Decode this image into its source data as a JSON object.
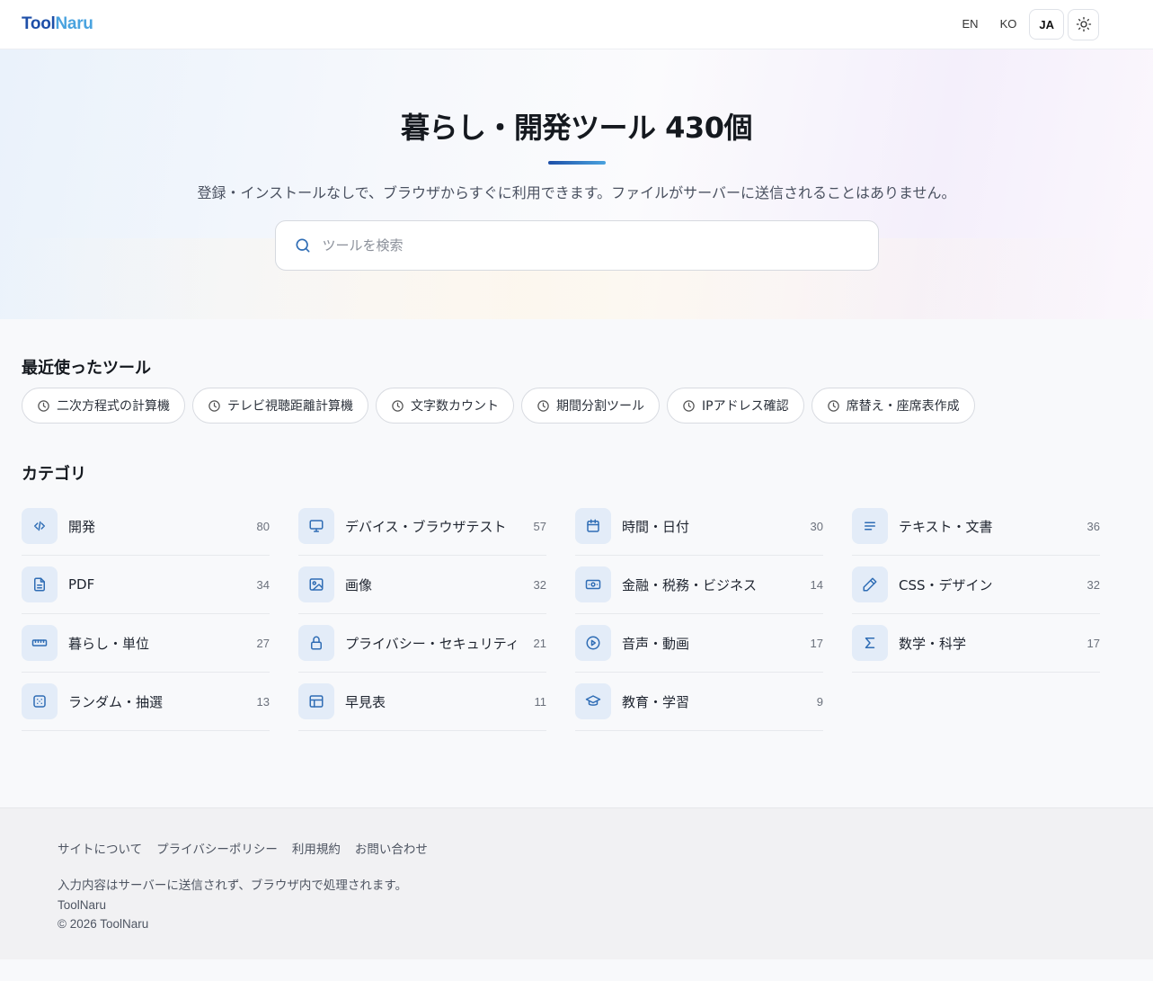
{
  "header": {
    "logo_part1": "Tool",
    "logo_part2": "Naru",
    "languages": [
      "EN",
      "KO",
      "JA"
    ],
    "active_language": "JA"
  },
  "hero": {
    "title": "暮らし・開発ツール 430個",
    "subtitle": "登録・インストールなしで、ブラウザからすぐに利用できます。ファイルがサーバーに送信されることはありません。",
    "search_placeholder": "ツールを検索"
  },
  "recent": {
    "title": "最近使ったツール",
    "items": [
      "二次方程式の計算機",
      "テレビ視聴距離計算機",
      "文字数カウント",
      "期間分割ツール",
      "IPアドレス確認",
      "席替え・座席表作成"
    ]
  },
  "categories": {
    "title": "カテゴリ",
    "items": [
      {
        "name": "開発",
        "count": "80",
        "icon": "code-icon"
      },
      {
        "name": "デバイス・ブラウザテスト",
        "count": "57",
        "icon": "monitor-icon"
      },
      {
        "name": "時間・日付",
        "count": "30",
        "icon": "calendar-icon"
      },
      {
        "name": "テキスト・文書",
        "count": "36",
        "icon": "text-lines-icon"
      },
      {
        "name": "PDF",
        "count": "34",
        "icon": "file-icon"
      },
      {
        "name": "画像",
        "count": "32",
        "icon": "image-icon"
      },
      {
        "name": "金融・税務・ビジネス",
        "count": "14",
        "icon": "banknote-icon"
      },
      {
        "name": "CSS・デザイン",
        "count": "32",
        "icon": "pencil-icon"
      },
      {
        "name": "暮らし・単位",
        "count": "27",
        "icon": "ruler-icon"
      },
      {
        "name": "プライバシー・セキュリティ",
        "count": "21",
        "icon": "lock-icon"
      },
      {
        "name": "音声・動画",
        "count": "17",
        "icon": "play-icon"
      },
      {
        "name": "数学・科学",
        "count": "17",
        "icon": "sigma-icon"
      },
      {
        "name": "ランダム・抽選",
        "count": "13",
        "icon": "dice-icon"
      },
      {
        "name": "早見表",
        "count": "11",
        "icon": "table-icon"
      },
      {
        "name": "教育・学習",
        "count": "9",
        "icon": "graduation-cap-icon"
      }
    ]
  },
  "footer": {
    "links": [
      "サイトについて",
      "プライバシーポリシー",
      "利用規約",
      "お問い合わせ"
    ],
    "note": "入力内容はサーバーに送信されず、ブラウザ内で処理されます。",
    "brand": "ToolNaru",
    "copyright": "© 2026 ToolNaru"
  },
  "colors": {
    "brand_dark": "#1e4fa8",
    "brand_light": "#4aa3df",
    "icon_bg": "#e3ecf8",
    "icon_stroke": "#2f6db5"
  }
}
